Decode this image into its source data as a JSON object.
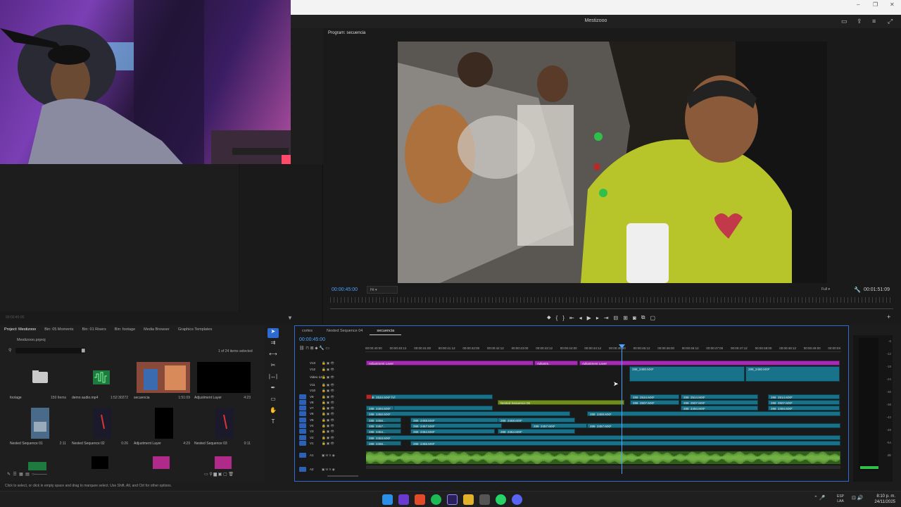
{
  "window": {
    "title": "Mestizooo",
    "controls": [
      "–",
      "❐",
      "✕"
    ]
  },
  "program_monitor": {
    "tab": "Program: secuencia",
    "timecode": "00:00:45:00",
    "fit": "Fit",
    "resolution": "Full",
    "duration": "00:01:51:09",
    "source_timecode": "00:00:45:00"
  },
  "project": {
    "tabs": [
      "Project: Mestizooo",
      "Bin: 05 Moments",
      "Bin: 01 Risers",
      "Bin: footage",
      "Media Browser",
      "Graphics Templates"
    ],
    "file": "Mestizooo.prproj",
    "selection": "1 of 24 items selected",
    "items": [
      {
        "name": "footage",
        "meta": "150 Items"
      },
      {
        "name": "demo audio.mp4",
        "meta": "1:52:30272"
      },
      {
        "name": "secuencia",
        "meta": "1:51:09"
      },
      {
        "name": "Adjustment Layer",
        "meta": "4:23"
      },
      {
        "name": "Nested Sequence 01",
        "meta": "2:11"
      },
      {
        "name": "Nested Sequence 02",
        "meta": "0:26"
      },
      {
        "name": "Adjustment Layer",
        "meta": "4:29"
      },
      {
        "name": "Nested Sequence 03",
        "meta": "0:11"
      }
    ]
  },
  "status_bar": "Click to select, or click in empty space and drag to marquee select. Use Shift, Alt, and Ctrl for other options.",
  "timeline": {
    "tabs": [
      "cortes",
      "Nested Sequence 04",
      "secuencia"
    ],
    "active_tab": 2,
    "timecode": "00:00:45:00",
    "ruler": [
      "00:00:40:00",
      "00:00:40:12",
      "00:00:41:00",
      "00:00:41:12",
      "00:00:42:00",
      "00:00:42:12",
      "00:00:43:00",
      "00:00:43:12",
      "00:00:44:00",
      "00:00:44:12",
      "00:00:45:00",
      "00:00:45:12",
      "00:00:46:00",
      "00:00:46:12",
      "00:00:47:00",
      "00:00:47:12",
      "00:00:48:00",
      "00:00:48:12",
      "00:00:49:00",
      "00:00:0X"
    ],
    "tracks": [
      "V13",
      "V12",
      "Video 12",
      "V11",
      "V10",
      "V9",
      "V8",
      "V7",
      "V6",
      "V5",
      "V4",
      "V3",
      "V2",
      "V1",
      "A1",
      "A2"
    ],
    "clips": {
      "adj1": "Adjustment Layer",
      "adj2": "Adjustm..",
      "adj3": "Adjustment Layer",
      "c2480a": "288_2480.MXF",
      "c2480b": "288_2480.MXF",
      "c2534a": "288_2534.MXF [V]",
      "c2534b": "288_2534.MXF",
      "c2514a": "288_2514.MXF",
      "c2514b": "288_2514.MXF",
      "c2507a": "288_2507.MXF",
      "c2507b": "288_2507.MXF",
      "c2507c": "288_2507.MXF",
      "c2507d": "288_2507.MXF",
      "nested06": "Nested Sequence 06",
      "c2494a": "288_2494.MXF",
      "c2494b": "288_2494.MXF",
      "c2494c": "288_2494.MXF",
      "c2450": "288_2450.MXF",
      "c2459": "288_2459.MXF",
      "c2456a": "288_2456...",
      "c2458a": "288_2458.MXF",
      "c2458b": "288_2458.MXF",
      "c2457a": "288_2457...",
      "c2457b": "288_2457.MXF",
      "c2457c": "288_2457.MXF",
      "c2457d": "288_2457.MXF",
      "c2454a": "288_2454...",
      "c2454b": "288_2454.MXF",
      "c2454c": "288_2454.MXF",
      "c2453": "288_2453.MXF",
      "c2456b": "288_2456...",
      "c2456c": "288_2456.MXF"
    }
  },
  "meter": [
    "-6",
    "-12",
    "-18",
    "-24",
    "-30",
    "-36",
    "-42",
    "-48",
    "-54",
    "dB"
  ],
  "taskbar": {
    "lang1": "ESP",
    "lang2": "LAA",
    "time": "8:10 p. m.",
    "date": "24/11/2025"
  },
  "colors": {
    "accent": "#4aa3ff",
    "clip_teal": "#18738a",
    "clip_purple": "#a62bb4",
    "clip_olive": "#6f8f1d",
    "audio": "#2f5f18"
  }
}
